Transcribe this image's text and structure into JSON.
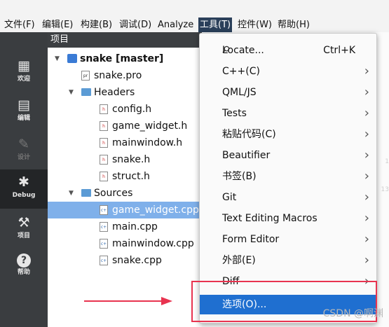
{
  "menubar": {
    "items": [
      "文件(F)",
      "编辑(E)",
      "构建(B)",
      "调试(D)",
      "Analyze",
      "工具(T)",
      "控件(W)",
      "帮助(H)"
    ],
    "active_index": 5
  },
  "sidebar": {
    "modes": [
      {
        "label": "欢迎",
        "icon": "grid-icon"
      },
      {
        "label": "编辑",
        "icon": "edit-icon"
      },
      {
        "label": "设计",
        "icon": "pen-icon"
      },
      {
        "label": "Debug",
        "icon": "bug-icon"
      },
      {
        "label": "项目",
        "icon": "wrench-icon"
      },
      {
        "label": "帮助",
        "icon": "help-icon"
      }
    ],
    "active": "Debug"
  },
  "project_panel": {
    "title": "项目",
    "tree": [
      {
        "label": "snake [master]",
        "kind": "project",
        "depth": 0,
        "expanded": true,
        "bold": true
      },
      {
        "label": "snake.pro",
        "kind": "pro-file",
        "depth": 1
      },
      {
        "label": "Headers",
        "kind": "folder",
        "depth": 1,
        "expanded": true
      },
      {
        "label": "config.h",
        "kind": "h-file",
        "depth": 2
      },
      {
        "label": "game_widget.h",
        "kind": "h-file",
        "depth": 2
      },
      {
        "label": "mainwindow.h",
        "kind": "h-file",
        "depth": 2
      },
      {
        "label": "snake.h",
        "kind": "h-file",
        "depth": 2
      },
      {
        "label": "struct.h",
        "kind": "h-file",
        "depth": 2
      },
      {
        "label": "Sources",
        "kind": "folder",
        "depth": 1,
        "expanded": true
      },
      {
        "label": "game_widget.cpp",
        "kind": "cpp-file",
        "depth": 2,
        "selected": true
      },
      {
        "label": "main.cpp",
        "kind": "cpp-file",
        "depth": 2
      },
      {
        "label": "mainwindow.cpp",
        "kind": "cpp-file",
        "depth": 2
      },
      {
        "label": "snake.cpp",
        "kind": "cpp-file",
        "depth": 2
      }
    ]
  },
  "tools_menu": {
    "items": [
      {
        "label": "Locate...",
        "shortcut": "Ctrl+K",
        "submenu": false,
        "icon": "search-icon"
      },
      {
        "label": "C++(C)",
        "submenu": true
      },
      {
        "label": "QML/JS",
        "submenu": true
      },
      {
        "label": "Tests",
        "submenu": true
      },
      {
        "label": "粘贴代码(C)",
        "submenu": true
      },
      {
        "label": "Beautifier",
        "submenu": true
      },
      {
        "label": "书签(B)",
        "submenu": true
      },
      {
        "label": "Git",
        "submenu": true
      },
      {
        "label": "Text Editing Macros",
        "submenu": true
      },
      {
        "label": "Form Editor",
        "submenu": true
      },
      {
        "label": "外部(E)",
        "submenu": true
      },
      {
        "label": "Diff",
        "submenu": true
      },
      {
        "label": "选项(O)...",
        "submenu": false,
        "highlighted": true
      }
    ]
  },
  "watermark": "CSDN @啊渊",
  "colors": {
    "highlight": "#1f6fd0",
    "selection": "#7fb0ea",
    "annotation": "#e8334f",
    "sidebar": "#3a3d40"
  }
}
